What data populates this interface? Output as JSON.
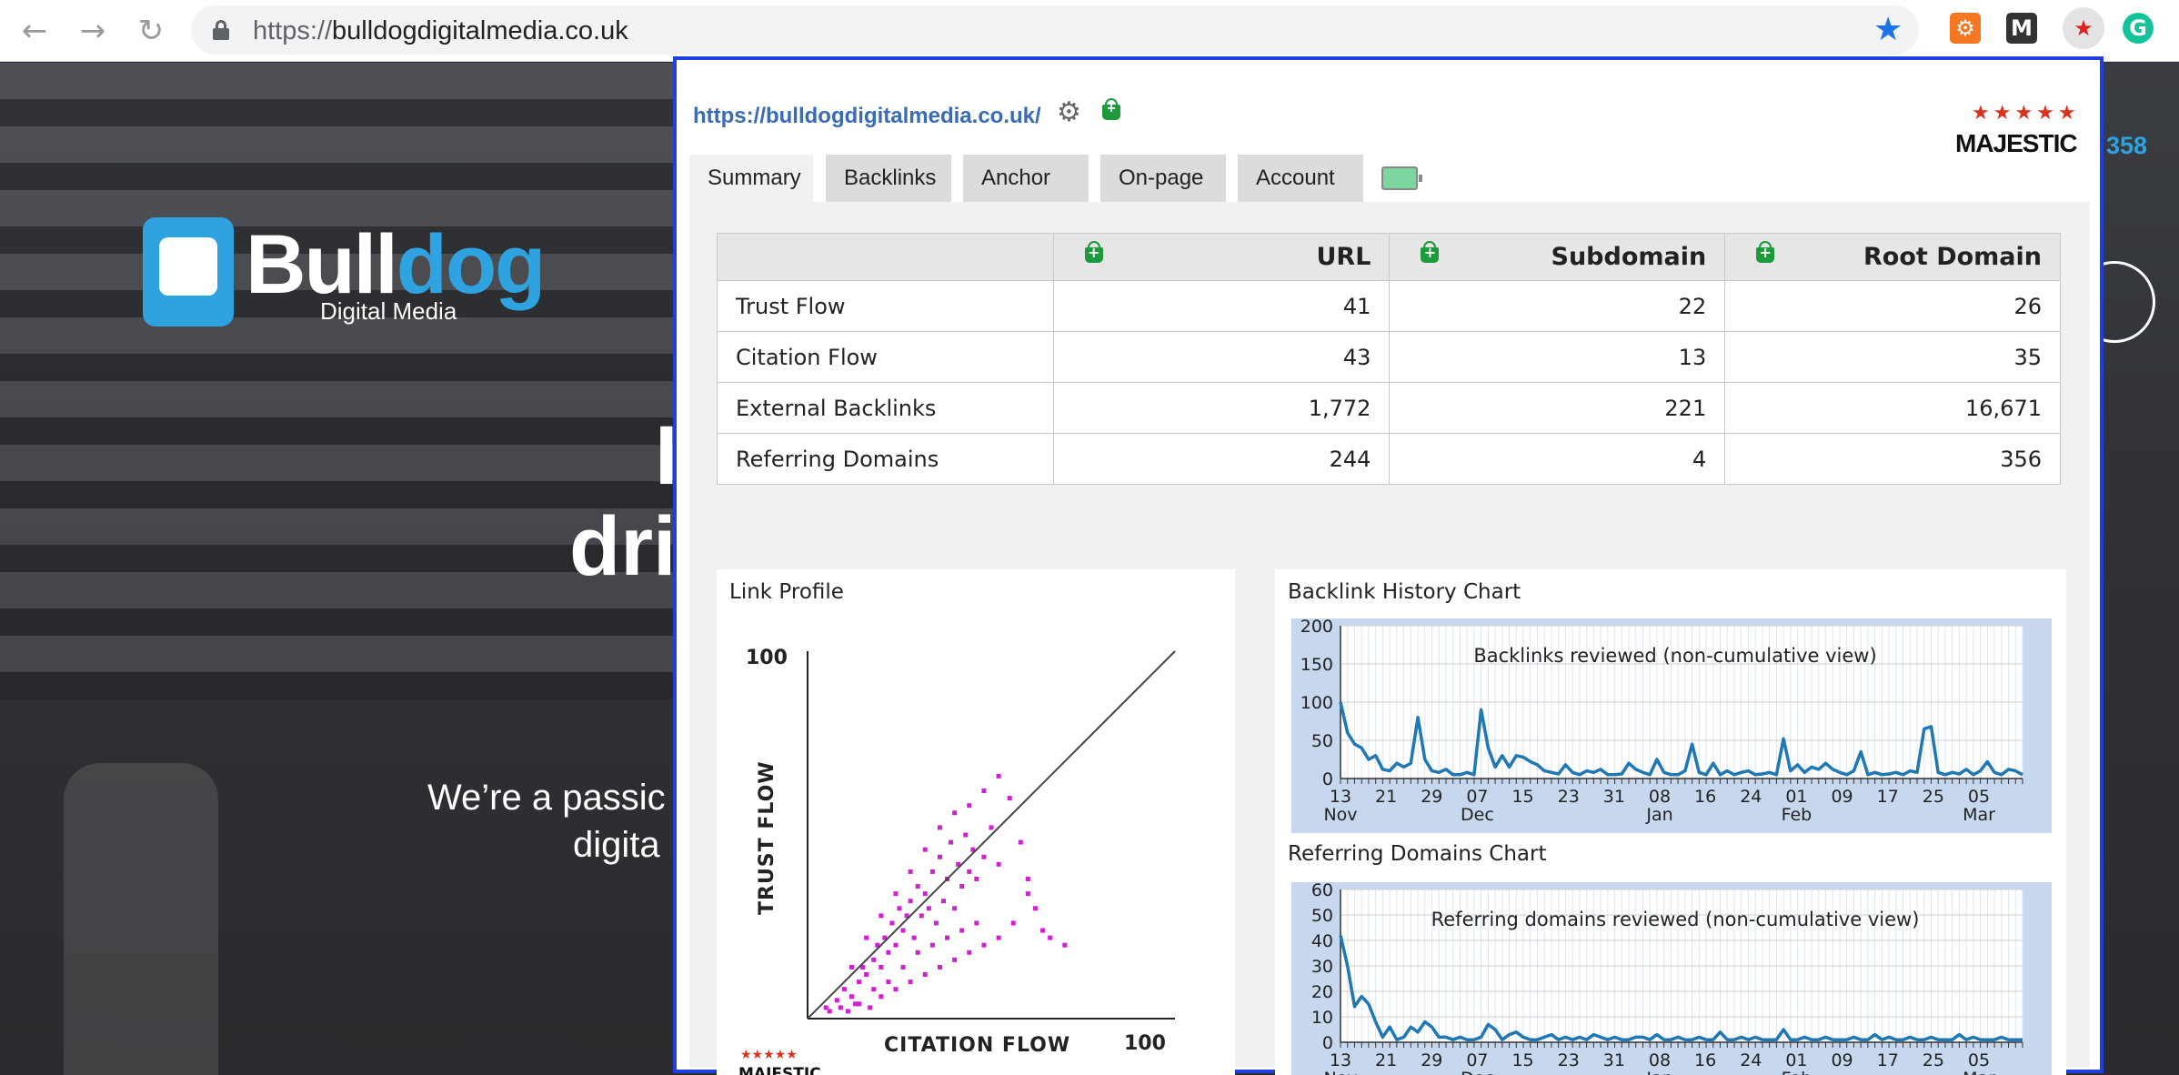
{
  "browser": {
    "url_scheme": "https://",
    "url_host": "bulldogdigitalmedia.co.uk",
    "back_icon": "arrow-left",
    "forward_icon": "arrow-right",
    "reload_icon": "reload",
    "bookmark_icon": "star",
    "extensions": [
      "hubspot",
      "medium",
      "majestic",
      "grammarly"
    ]
  },
  "website": {
    "logo_bull": "Bull",
    "logo_dog": "dog",
    "logo_sub": "Digital Media",
    "hero_line1": "I",
    "hero_line2": "dri",
    "hero_sub1": "We’re a passic",
    "hero_sub2": "digita",
    "phone_fragment": "358"
  },
  "popup": {
    "url": "https://bulldogdigitalmedia.co.uk/",
    "brand": "MAJESTIC",
    "tabs": [
      {
        "label": "Summary",
        "active": true
      },
      {
        "label": "Backlinks",
        "active": false
      },
      {
        "label": "Anchor Text",
        "active": false
      },
      {
        "label": "On-page Links",
        "active": false
      },
      {
        "label": "Account",
        "active": false
      }
    ],
    "table": {
      "headers": [
        "",
        "URL",
        "Subdomain",
        "Root Domain"
      ],
      "rows": [
        {
          "label": "Trust Flow",
          "values": [
            "41",
            "22",
            "26"
          ]
        },
        {
          "label": "Citation Flow",
          "values": [
            "43",
            "13",
            "35"
          ]
        },
        {
          "label": "External Backlinks",
          "values": [
            "1,772",
            "221",
            "16,671"
          ]
        },
        {
          "label": "Referring Domains",
          "values": [
            "244",
            "4",
            "356"
          ]
        }
      ]
    },
    "link_profile": {
      "title": "Link Profile",
      "y_label": "TRUST FLOW",
      "x_label": "CITATION FLOW",
      "y_max_label": "100",
      "x_max_label": "100",
      "footer_brand": "MAJESTIC"
    },
    "backlink_history": {
      "title": "Backlink History Chart",
      "subtitle": "Backlinks reviewed (non-cumulative view)"
    },
    "referring_domains": {
      "title": "Referring Domains Chart",
      "subtitle": "Referring domains reviewed (non-cumulative view)"
    }
  },
  "chart_data": [
    {
      "type": "scatter",
      "title": "Link Profile",
      "xlabel": "CITATION FLOW",
      "ylabel": "TRUST FLOW",
      "xlim": [
        0,
        100
      ],
      "ylim": [
        0,
        100
      ],
      "color": "#d020d0",
      "points": [
        [
          5,
          3
        ],
        [
          8,
          5
        ],
        [
          10,
          8
        ],
        [
          12,
          6
        ],
        [
          14,
          10
        ],
        [
          15,
          14
        ],
        [
          16,
          12
        ],
        [
          18,
          16
        ],
        [
          19,
          20
        ],
        [
          20,
          14
        ],
        [
          21,
          22
        ],
        [
          22,
          18
        ],
        [
          23,
          26
        ],
        [
          24,
          20
        ],
        [
          25,
          30
        ],
        [
          26,
          24
        ],
        [
          27,
          28
        ],
        [
          28,
          32
        ],
        [
          29,
          22
        ],
        [
          30,
          36
        ],
        [
          31,
          28
        ],
        [
          32,
          34
        ],
        [
          33,
          30
        ],
        [
          34,
          40
        ],
        [
          35,
          26
        ],
        [
          36,
          44
        ],
        [
          37,
          32
        ],
        [
          38,
          38
        ],
        [
          39,
          48
        ],
        [
          40,
          30
        ],
        [
          41,
          42
        ],
        [
          42,
          36
        ],
        [
          43,
          50
        ],
        [
          44,
          40
        ],
        [
          45,
          46
        ],
        [
          46,
          38
        ],
        [
          48,
          44
        ],
        [
          50,
          52
        ],
        [
          52,
          42
        ],
        [
          55,
          60
        ],
        [
          58,
          48
        ],
        [
          60,
          38
        ],
        [
          62,
          30
        ],
        [
          64,
          24
        ],
        [
          66,
          22
        ],
        [
          70,
          20
        ],
        [
          22,
          10
        ],
        [
          26,
          14
        ],
        [
          30,
          18
        ],
        [
          34,
          20
        ],
        [
          38,
          22
        ],
        [
          42,
          24
        ],
        [
          46,
          26
        ],
        [
          18,
          8
        ],
        [
          14,
          4
        ],
        [
          20,
          6
        ],
        [
          24,
          8
        ],
        [
          28,
          10
        ],
        [
          32,
          12
        ],
        [
          36,
          14
        ],
        [
          40,
          16
        ],
        [
          44,
          18
        ],
        [
          48,
          20
        ],
        [
          52,
          22
        ],
        [
          56,
          26
        ],
        [
          60,
          34
        ],
        [
          6,
          2
        ],
        [
          9,
          3
        ],
        [
          11,
          2
        ],
        [
          13,
          4
        ],
        [
          17,
          3
        ],
        [
          12,
          14
        ],
        [
          16,
          22
        ],
        [
          20,
          28
        ],
        [
          24,
          34
        ],
        [
          28,
          40
        ],
        [
          32,
          46
        ],
        [
          36,
          52
        ],
        [
          40,
          56
        ],
        [
          44,
          58
        ],
        [
          48,
          62
        ],
        [
          52,
          66
        ]
      ],
      "diagonal": true
    },
    {
      "type": "line",
      "title": "Backlink History Chart",
      "subtitle": "Backlinks reviewed (non-cumulative view)",
      "ylim": [
        0,
        200
      ],
      "yticks": [
        0,
        50,
        100,
        150,
        200
      ],
      "xtick_labels": [
        "13",
        "21",
        "29",
        "07",
        "15",
        "23",
        "31",
        "08",
        "16",
        "24",
        "01",
        "09",
        "17",
        "25",
        "05"
      ],
      "month_labels": [
        "Nov",
        "Dec",
        "Jan",
        "Feb",
        "Mar"
      ],
      "color": "#1f77b4",
      "values": [
        100,
        60,
        45,
        40,
        25,
        30,
        12,
        10,
        20,
        15,
        20,
        80,
        25,
        10,
        8,
        12,
        5,
        5,
        8,
        5,
        90,
        40,
        15,
        30,
        15,
        30,
        28,
        22,
        18,
        10,
        8,
        6,
        18,
        8,
        5,
        10,
        8,
        12,
        5,
        5,
        6,
        20,
        12,
        8,
        5,
        25,
        8,
        5,
        5,
        10,
        45,
        8,
        5,
        20,
        5,
        10,
        5,
        8,
        10,
        5,
        6,
        8,
        5,
        52,
        10,
        18,
        8,
        15,
        12,
        20,
        12,
        8,
        5,
        10,
        35,
        5,
        8,
        5,
        6,
        8,
        5,
        10,
        8,
        65,
        68,
        8,
        5,
        8,
        6,
        12,
        5,
        10,
        22,
        8,
        5,
        12,
        10,
        5
      ],
      "grid": true
    },
    {
      "type": "line",
      "title": "Referring Domains Chart",
      "subtitle": "Referring domains reviewed (non-cumulative view)",
      "ylim": [
        0,
        60
      ],
      "yticks": [
        0,
        10,
        20,
        30,
        40,
        50,
        60
      ],
      "xtick_labels": [
        "13",
        "21",
        "29",
        "07",
        "15",
        "23",
        "31",
        "08",
        "16",
        "24",
        "01",
        "09",
        "17",
        "25",
        "05"
      ],
      "month_labels": [
        "Nov",
        "Dec",
        "Jan",
        "Feb",
        "Mar"
      ],
      "color": "#1f77b4",
      "values": [
        42,
        30,
        14,
        18,
        15,
        8,
        2,
        6,
        1,
        2,
        6,
        4,
        8,
        6,
        2,
        2,
        1,
        2,
        1,
        1,
        2,
        7,
        5,
        1,
        3,
        4,
        2,
        1,
        1,
        2,
        3,
        1,
        2,
        1,
        2,
        1,
        3,
        2,
        1,
        2,
        1,
        1,
        2,
        2,
        1,
        3,
        1,
        1,
        2,
        1,
        1,
        2,
        1,
        1,
        4,
        1,
        1,
        2,
        1,
        2,
        1,
        1,
        1,
        5,
        1,
        1,
        2,
        1,
        1,
        2,
        1,
        1,
        1,
        2,
        1,
        1,
        3,
        1,
        2,
        1,
        1,
        2,
        1,
        1,
        2,
        1,
        1,
        1,
        3,
        1,
        2,
        1,
        1,
        1,
        2,
        1,
        1,
        1
      ],
      "grid": true
    }
  ]
}
